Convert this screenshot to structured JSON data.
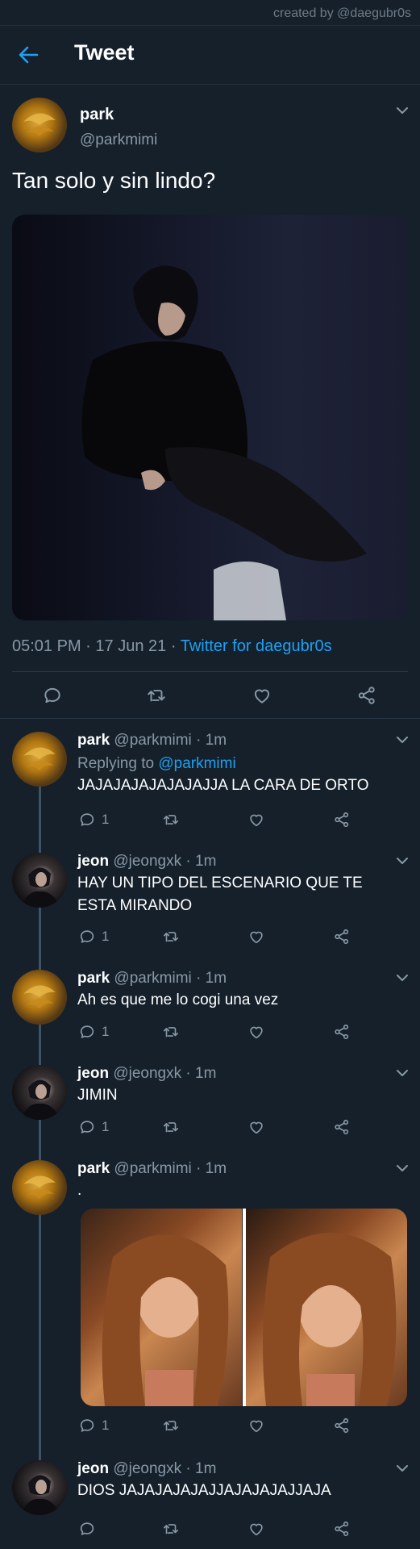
{
  "credit": "created by @daegubr0s",
  "header": {
    "title": "Tweet"
  },
  "main_tweet": {
    "name": "park",
    "handle": "@parkmimi",
    "text": "Tan solo y sin lindo?",
    "time": "05:01 PM",
    "date": "17 Jun 21",
    "source": "Twitter for daegubr0s",
    "sep": "·"
  },
  "replies": [
    {
      "name": "park",
      "handle": "@parkmimi",
      "time": "1m",
      "replying_label": "Replying to",
      "replying_to": "@parkmimi",
      "text": "JAJAJAJAJAJAJAJJA LA CARA DE ORTO",
      "replies_count": "1"
    },
    {
      "name": "jeon",
      "handle": "@jeongxk",
      "time": "1m",
      "text_line1": "HAY UN TIPO DEL ESCENARIO QUE TE",
      "text_line2": "ESTA MIRANDO",
      "replies_count": "1"
    },
    {
      "name": "park",
      "handle": "@parkmimi",
      "time": "1m",
      "text": "Ah es que me lo cogi una vez",
      "replies_count": "1"
    },
    {
      "name": "jeon",
      "handle": "@jeongxk",
      "time": "1m",
      "text": "JIMIN",
      "replies_count": "1"
    },
    {
      "name": "park",
      "handle": "@parkmimi",
      "time": "1m",
      "text": ".",
      "replies_count": "1"
    },
    {
      "name": "jeon",
      "handle": "@jeongxk",
      "time": "1m",
      "text": "DIOS JAJAJAJAJAJJAJAJAJAJJAJA"
    }
  ],
  "icons": {
    "back": "arrow-left-icon",
    "reply": "comment-icon",
    "retweet": "retweet-icon",
    "like": "heart-icon",
    "share": "share-icon",
    "more": "chevron-down-icon"
  },
  "colors": {
    "background": "#15202b",
    "accent": "#1da1f2",
    "muted": "#8899a6"
  }
}
